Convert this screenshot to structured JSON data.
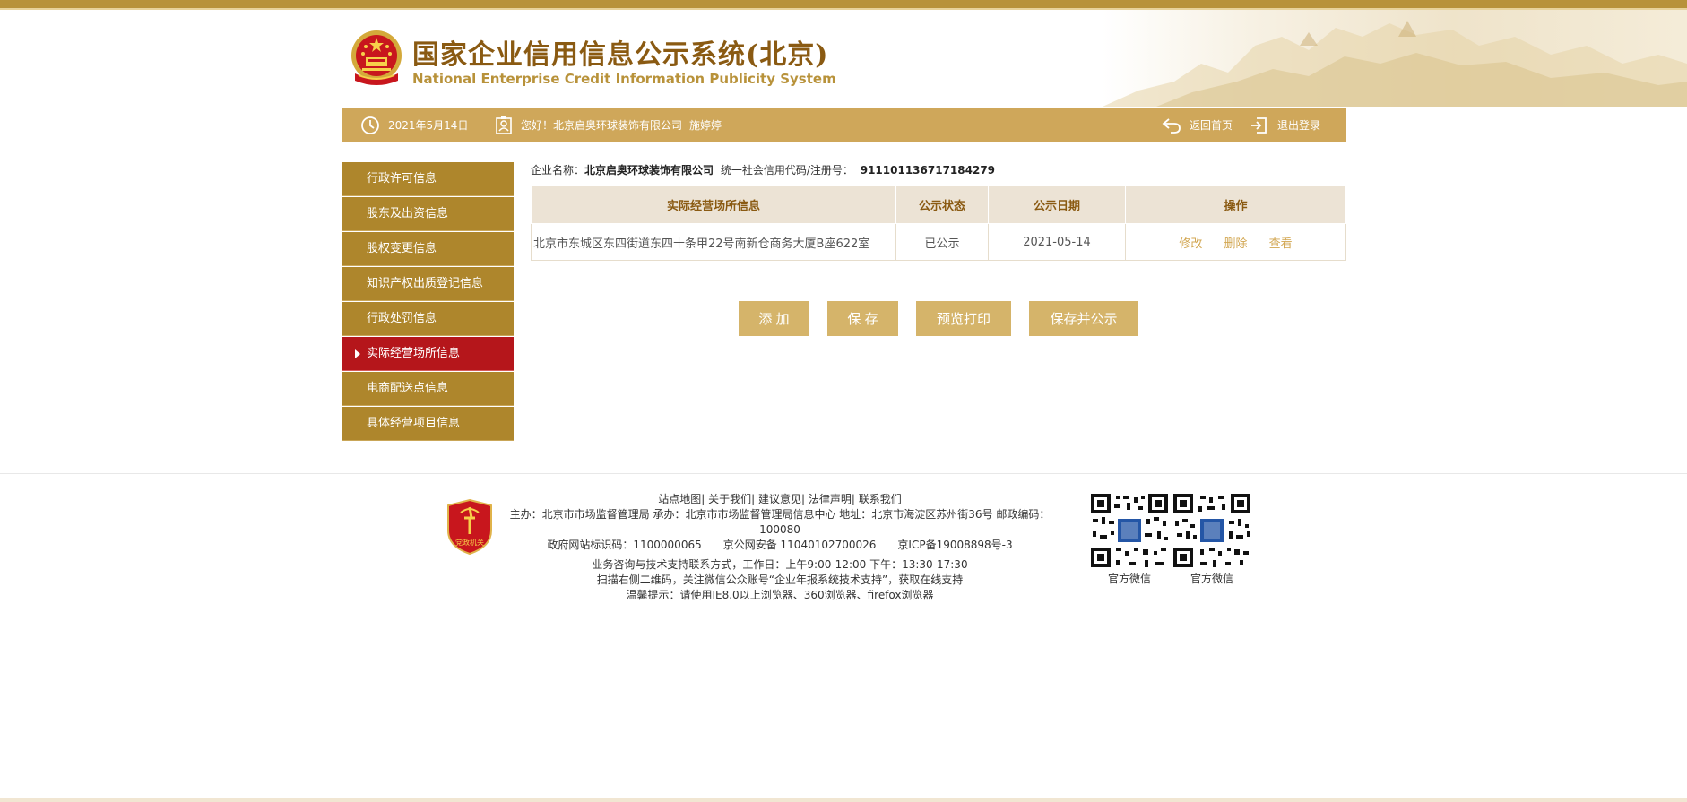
{
  "header": {
    "title": "国家企业信用信息公示系统(北京)",
    "subtitle": "National Enterprise Credit Information Publicity System",
    "emblem_icon": "national-emblem-icon"
  },
  "navbar": {
    "date": "2021年5月14日",
    "greeting": "您好！北京启奥环球装饰有限公司",
    "username": "施婷婷",
    "home_label": "返回首页",
    "logout_label": "退出登录"
  },
  "sidebar": {
    "items": [
      {
        "label": "行政许可信息"
      },
      {
        "label": "股东及出资信息"
      },
      {
        "label": "股权变更信息"
      },
      {
        "label": "知识产权出质登记信息"
      },
      {
        "label": "行政处罚信息"
      },
      {
        "label": "实际经营场所信息",
        "active": true
      },
      {
        "label": "电商配送点信息"
      },
      {
        "label": "具体经营项目信息"
      }
    ]
  },
  "company": {
    "name_label": "企业名称：",
    "name": "北京启奥环球装饰有限公司",
    "code_label": "统一社会信用代码/注册号：",
    "code": "911101136717184279"
  },
  "table": {
    "columns": [
      "实际经营场所信息",
      "公示状态",
      "公示日期",
      "操作"
    ],
    "rows": [
      {
        "address": "北京市东城区东四街道东四十条甲22号南新仓商务大厦B座622室",
        "status": "已公示",
        "date": "2021-05-14",
        "ops": [
          "修改",
          "删除",
          "查看"
        ]
      }
    ]
  },
  "buttons": {
    "add": "添 加",
    "save": "保 存",
    "preview": "预览打印",
    "save_publish": "保存并公示"
  },
  "footer": {
    "links": "站点地图| 关于我们| 建议意见| 法律声明| 联系我们",
    "host_line": "主办：北京市市场监督管理局 承办：北京市市场监督管理局信息中心 地址：北京市海淀区苏州街36号 邮政编码：100080",
    "record_line": "政府网站标识码：1100000065　　京公网安备 11040102700026　　京ICP备19008898号-3",
    "support_line": "业务咨询与技术支持联系方式，工作日：上午9:00-12:00 下午：13:30-17:30",
    "scan_line": "扫描右侧二维码，关注微信公众账号“企业年报系统技术支持”，获取在线支持",
    "tip_line": "温馨提示：请使用IE8.0以上浏览器、360浏览器、firefox浏览器",
    "badge_text": "党政机关",
    "qr1_label": "官方微信",
    "qr2_label": "官方微信"
  },
  "colors": {
    "gold": "#cfa75a",
    "sidebar": "#ae862c",
    "active": "#b5161b",
    "button": "#d5b46a",
    "title": "#8a5a12"
  }
}
